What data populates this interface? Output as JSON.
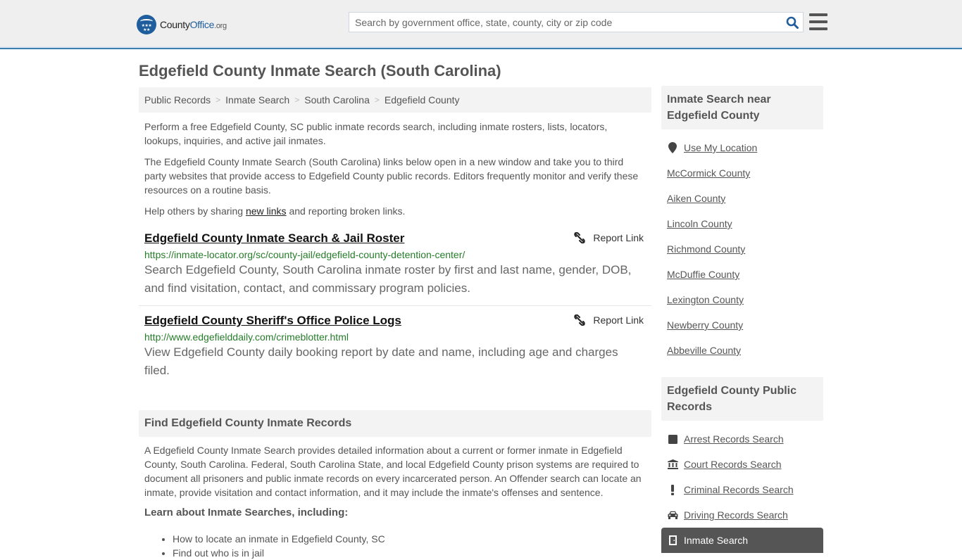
{
  "header": {
    "logo": {
      "name": "CountyOffice",
      "name_part1": "County",
      "name_part2": "Office",
      "tld": ".org"
    },
    "search_placeholder": "Search by government office, state, county, city or zip code",
    "search_value": "",
    "colors": {
      "brand": "#1f5d9c",
      "accent_border": "#3a7fb0"
    }
  },
  "page": {
    "title": "Edgefield County Inmate Search (South Carolina)"
  },
  "breadcrumb": [
    {
      "label": "Public Records"
    },
    {
      "label": "Inmate Search"
    },
    {
      "label": "South Carolina"
    },
    {
      "label": "Edgefield County"
    }
  ],
  "breadcrumb_separator": ">",
  "intro": {
    "p1": "Perform a free Edgefield County, SC public inmate records search, including inmate rosters, lists, locators, lookups, inquiries, and active jail inmates.",
    "p2": "The Edgefield County Inmate Search (South Carolina) links below open in a new window and take you to third party websites that provide access to Edgefield County public records. Editors frequently monitor and verify these resources on a routine basis.",
    "p3_before": "Help others by sharing ",
    "p3_link": "new links",
    "p3_after": " and reporting broken links."
  },
  "links": [
    {
      "title": "Edgefield County Inmate Search & Jail Roster",
      "url": "https://inmate-locator.org/sc/county-jail/edgefield-county-detention-center/",
      "description": "Search Edgefield County, South Carolina inmate roster by first and last name, gender, DOB, and find visitation, contact, and commissary program policies.",
      "report_label": "Report Link"
    },
    {
      "title": "Edgefield County Sheriff's Office Police Logs",
      "url": "http://www.edgefielddaily.com/crimeblotter.html",
      "description": "View Edgefield County daily booking report by date and name, including age and charges filed.",
      "report_label": "Report Link"
    }
  ],
  "find_section": {
    "heading": "Find Edgefield County Inmate Records",
    "paragraph": "A Edgefield County Inmate Search provides detailed information about a current or former inmate in Edgefield County, South Carolina. Federal, South Carolina State, and local Edgefield County prison systems are required to document all prisoners and public inmate records on every incarcerated person. An Offender search can locate an inmate, provide visitation and contact information, and it may include the inmate's offenses and sentence.",
    "learn_heading": "Learn about Inmate Searches, including:",
    "bullets": [
      "How to locate an inmate in Edgefield County, SC",
      "Find out who is in jail"
    ]
  },
  "sidebar": {
    "nearby_heading": "Inmate Search near Edgefield County",
    "nearby": [
      {
        "label": "Use My Location",
        "icon": "map-marker-icon"
      },
      {
        "label": "McCormick County"
      },
      {
        "label": "Aiken County"
      },
      {
        "label": "Lincoln County"
      },
      {
        "label": "Richmond County"
      },
      {
        "label": "McDuffie County"
      },
      {
        "label": "Lexington County"
      },
      {
        "label": "Newberry County"
      },
      {
        "label": "Abbeville County"
      }
    ],
    "records_heading": "Edgefield County Public Records",
    "records": [
      {
        "label": "Arrest Records Search",
        "icon": "square-icon"
      },
      {
        "label": "Court Records Search",
        "icon": "courthouse-icon"
      },
      {
        "label": "Criminal Records Search",
        "icon": "exclamation-icon"
      },
      {
        "label": "Driving Records Search",
        "icon": "car-icon"
      },
      {
        "label": "Inmate Search",
        "icon": "door-icon",
        "active": true
      }
    ]
  }
}
